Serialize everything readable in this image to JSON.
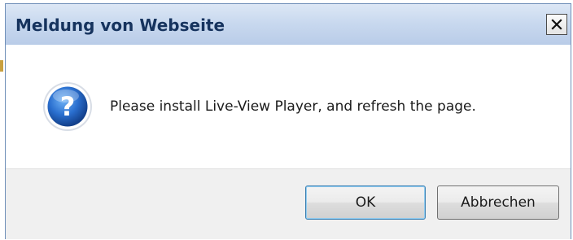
{
  "dialog": {
    "title": "Meldung von Webseite",
    "close_icon": "close-x-icon",
    "message": "Please install Live-View Player, and refresh the page.",
    "message_icon": "question-icon",
    "buttons": {
      "ok_label": "OK",
      "cancel_label": "Abbrechen"
    }
  },
  "colors": {
    "title_text": "#16335e",
    "titlebar": "#c9d9ef",
    "body_background": "#ffffff",
    "footer_background": "#f0f0f0",
    "icon_blue": "#1f5fb8"
  }
}
